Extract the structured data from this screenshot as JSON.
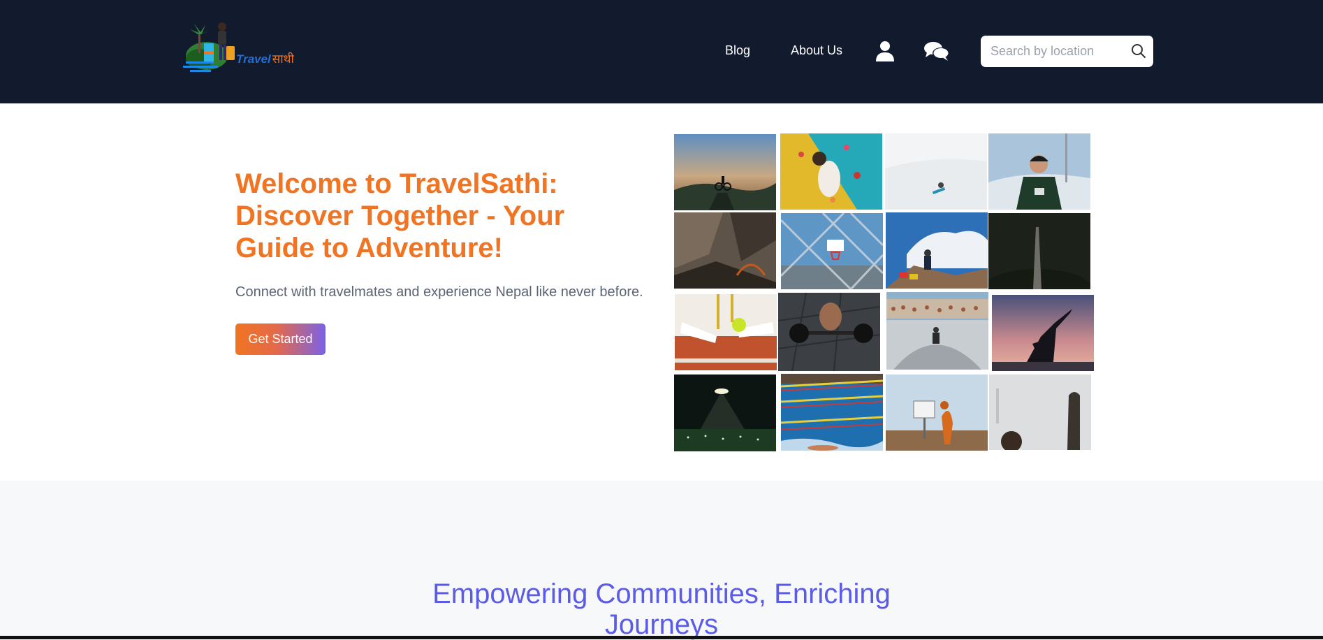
{
  "header": {
    "logo": {
      "brand_latin": "Travel",
      "brand_devanagari": "साथी"
    },
    "nav": {
      "blog": "Blog",
      "about": "About Us"
    },
    "icons": {
      "user": "user-icon",
      "chat": "chat-icon",
      "search": "search-icon"
    },
    "search": {
      "placeholder": "Search by location",
      "value": ""
    }
  },
  "hero": {
    "title": "Welcome to TravelSathi: Discover Together - Your Guide to Adventure!",
    "subtitle": "Connect with travelmates and experience Nepal like never before.",
    "cta_label": "Get Started"
  },
  "gallery": {
    "images": [
      "mountain-biker-at-sunset",
      "indoor-rock-climbing",
      "snowboarder-in-sky",
      "football-player-celebrating",
      "rocky-cliff-close-up",
      "basketball-hoop-through-fence",
      "hiker-on-snowy-mountain",
      "dark-still-life",
      "tennis-shoes-and-racket",
      "weightlifting-barbell",
      "skatepark-crowd",
      "yoga-pose-at-sunset",
      "stadium-floodlight-at-night",
      "swimming-pool-lanes",
      "basketball-dunk",
      "basketball-close-up"
    ]
  },
  "section2": {
    "title_line1": "Empowering Communities, Enriching",
    "title_line2": "Journeys"
  },
  "colors": {
    "navbar_bg": "#121a2e",
    "accent_orange": "#f07422",
    "accent_purple": "#5b5be6",
    "section2_bg": "#f7f8fa"
  }
}
